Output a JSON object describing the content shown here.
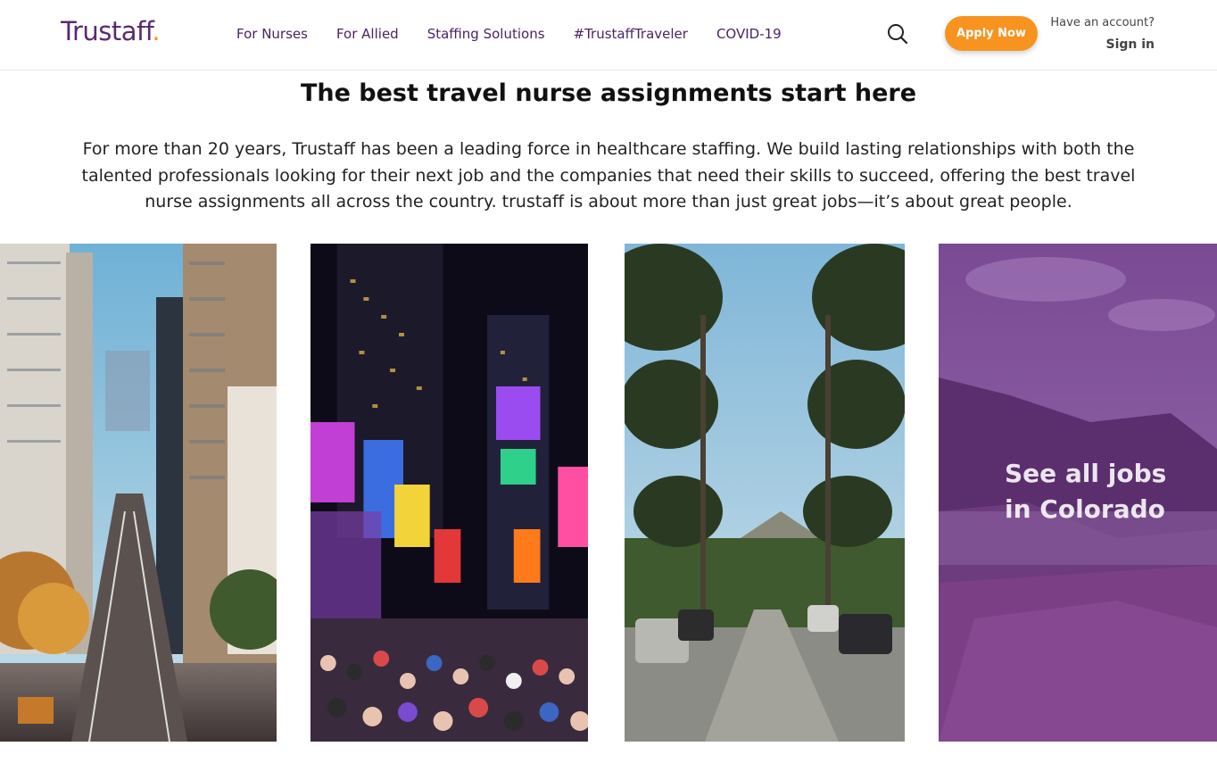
{
  "header": {
    "logo": "Trustaff",
    "logo_dot": ".",
    "nav": [
      {
        "label": "For Nurses"
      },
      {
        "label": "For Allied"
      },
      {
        "label": "Staffing Solutions"
      },
      {
        "label": "#TrustaffTraveler"
      },
      {
        "label": "COVID-19"
      }
    ],
    "search_icon": "search-icon",
    "apply_label": "Apply Now",
    "account_question": "Have an account?",
    "sign_in": "Sign in"
  },
  "hero": {
    "title": "The best travel nurse assignments start here",
    "intro": "For more than 20 years, Trustaff has been a leading force in healthcare staffing. We build lasting relationships with both the talented professionals looking for their next job and the companies that need their skills to succeed, offering the best travel nurse assignments all across the country. trustaff is about more than just great jobs—it’s about great people."
  },
  "tiles": [
    {
      "photo": "san-francisco-street"
    },
    {
      "photo": "times-square-new-york"
    },
    {
      "photo": "los-angeles-palm-street"
    },
    {
      "photo": "colorado-landscape",
      "label_line1": "See all jobs",
      "label_line2": "in Colorado"
    }
  ],
  "colors": {
    "brand_purple": "#5b2a6e",
    "accent_orange": "#f7931e",
    "tile_overlay": "#6b3a82"
  }
}
